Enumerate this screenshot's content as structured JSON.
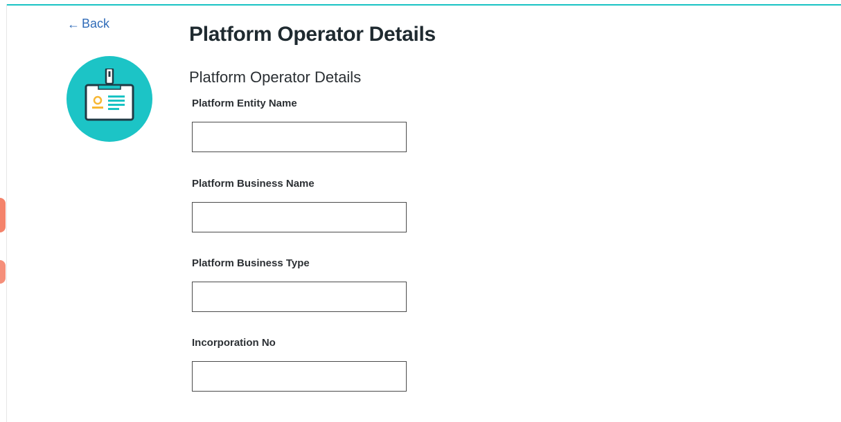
{
  "nav": {
    "back_label": "Back",
    "back_icon": "arrow-left-icon"
  },
  "header": {
    "title": "Platform Operator Details",
    "badge_icon": "id-card-badge-icon"
  },
  "form": {
    "section_title": "Platform Operator Details",
    "fields": [
      {
        "label": "Platform Entity Name",
        "value": "",
        "placeholder": ""
      },
      {
        "label": "Platform Business Name",
        "value": "",
        "placeholder": ""
      },
      {
        "label": "Platform Business Type",
        "value": "",
        "placeholder": ""
      },
      {
        "label": "Incorporation No",
        "value": "",
        "placeholder": ""
      }
    ]
  },
  "colors": {
    "accent": "#19c3c4",
    "link": "#2f6bb8",
    "badge_yellow": "#f7b733",
    "badge_dark": "#1f3a44"
  }
}
